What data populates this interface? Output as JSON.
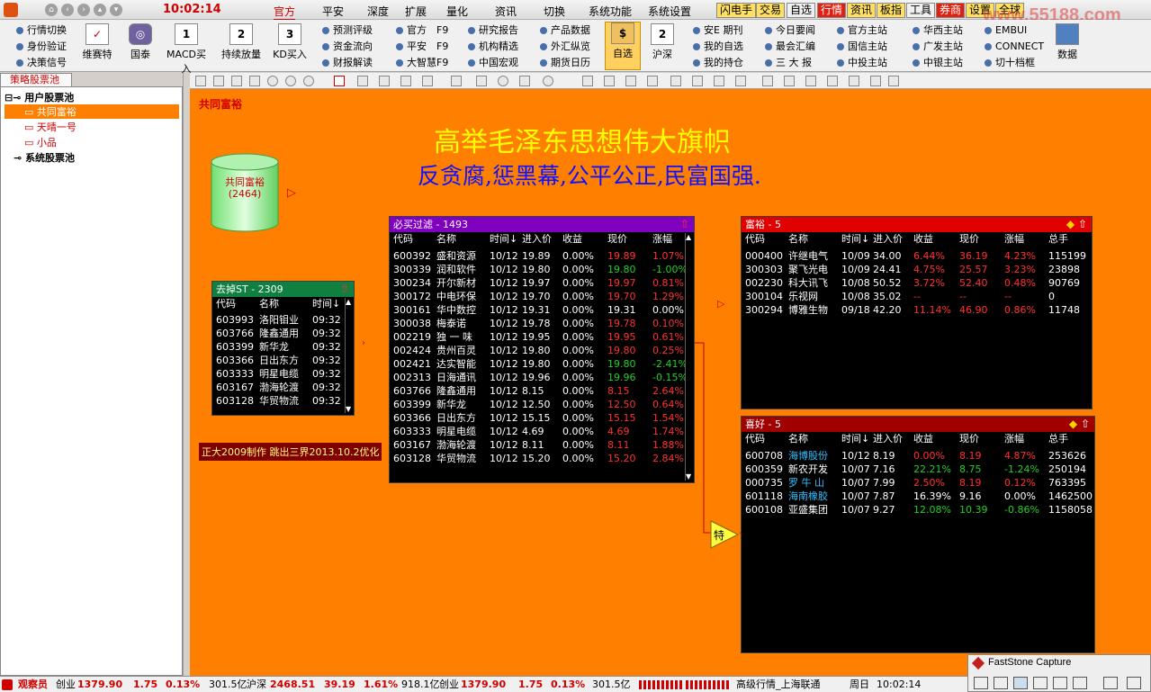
{
  "topbar": {
    "time": "10:02:14",
    "menus": [
      "官方",
      "平安",
      "深度",
      "扩展",
      "量化",
      "资讯",
      "切换",
      "系统功能",
      "系统设置"
    ],
    "buttons": [
      "闪电手",
      "交易",
      "自选",
      "行情",
      "资讯",
      "板指",
      "工具",
      "券商",
      "设置",
      "全球"
    ],
    "watermark": "www.55188.com"
  },
  "toolbar": {
    "col1": [
      "行情切换",
      "身份验证",
      "决策信号"
    ],
    "big1": [
      {
        "label": "维赛特",
        "icon": "check-icon"
      },
      {
        "label": "国泰",
        "icon": "gauge-icon"
      },
      {
        "label": "MACD买入",
        "num": "1"
      },
      {
        "label": "持续放量",
        "num": "2"
      },
      {
        "label": "KD买入",
        "num": "3"
      }
    ],
    "col2": [
      "预测评级",
      "资金流向",
      "财报解读"
    ],
    "col3": [
      "官方　F9",
      "平安　F9",
      "大智慧F9"
    ],
    "col4": [
      "研究报告",
      "机构精选",
      "中国宏观"
    ],
    "col5": [
      "产品数据",
      "外汇纵览",
      "期货日历"
    ],
    "big2": [
      {
        "label": "自选",
        "num": "$"
      },
      {
        "label": "沪深",
        "num": "2"
      }
    ],
    "col6": [
      "安E 期刊",
      "我的自选",
      "我的持仓"
    ],
    "col7": [
      "今日要闻",
      "最会汇编",
      "三 大 报"
    ],
    "col8": [
      "官方主站",
      "国信主站",
      "中投主站"
    ],
    "col9": [
      "华西主站",
      "广发主站",
      "中银主站"
    ],
    "col10": [
      "EMBUI",
      "CONNECT",
      "切十档框"
    ],
    "big3": {
      "label": "数据"
    }
  },
  "left": {
    "tab": "策略股票池",
    "tree": [
      {
        "label": "用户股票池",
        "level": 0,
        "bold": true
      },
      {
        "label": "共同富裕",
        "level": 1,
        "selected": true
      },
      {
        "label": "天晴一号",
        "level": 1
      },
      {
        "label": "小品",
        "level": 1
      },
      {
        "label": "系统股票池",
        "level": 0,
        "bold": true
      }
    ]
  },
  "canvas": {
    "pool_title": "共同富裕",
    "headline": "高举毛泽东思想伟大旗帜",
    "subline": "反贪腐,惩黑幕,公平公正,民富国强.",
    "cylinder": {
      "name": "共同富裕",
      "count": "(2464)"
    },
    "note": "正大2009制作 跳出三界2013.10.2优化",
    "special": "特"
  },
  "panels": {
    "qudiao": {
      "title": "去掉ST - 2309",
      "headers": [
        "代码",
        "名称",
        "时间↓"
      ],
      "rows": [
        [
          "603993",
          "洛阳钼业",
          "09:32"
        ],
        [
          "603766",
          "隆鑫通用",
          "09:32"
        ],
        [
          "603399",
          "新华龙",
          "09:32"
        ],
        [
          "603366",
          "日出东方",
          "09:32"
        ],
        [
          "603333",
          "明星电缆",
          "09:32"
        ],
        [
          "603167",
          "渤海轮渡",
          "09:32"
        ],
        [
          "603128",
          "华贸物流",
          "09:32"
        ]
      ]
    },
    "bimai": {
      "title": "必买过滤 - 1493",
      "headers": [
        "代码",
        "名称",
        "时间↓",
        "进入价",
        "收益",
        "现价",
        "涨幅"
      ],
      "rows": [
        [
          "600392",
          "盛和资源",
          "10/12",
          "19.89",
          "0.00%",
          "19.89",
          "1.07%",
          "r"
        ],
        [
          "300339",
          "润和软件",
          "10/12",
          "19.80",
          "0.00%",
          "19.80",
          "-1.00%",
          "g"
        ],
        [
          "300234",
          "开尔新材",
          "10/12",
          "19.97",
          "0.00%",
          "19.97",
          "0.81%",
          "r"
        ],
        [
          "300172",
          "中电环保",
          "10/12",
          "19.70",
          "0.00%",
          "19.70",
          "1.29%",
          "r"
        ],
        [
          "300161",
          "华中数控",
          "10/12",
          "19.31",
          "0.00%",
          "19.31",
          "0.00%",
          "w"
        ],
        [
          "300038",
          "梅泰诺",
          "10/12",
          "19.78",
          "0.00%",
          "19.78",
          "0.10%",
          "r"
        ],
        [
          "002219",
          "独 一 味",
          "10/12",
          "19.95",
          "0.00%",
          "19.95",
          "0.61%",
          "r"
        ],
        [
          "002424",
          "贵州百灵",
          "10/12",
          "19.80",
          "0.00%",
          "19.80",
          "0.25%",
          "r"
        ],
        [
          "002421",
          "达实智能",
          "10/12",
          "19.80",
          "0.00%",
          "19.80",
          "-2.41%",
          "g"
        ],
        [
          "002313",
          "日海通讯",
          "10/12",
          "19.96",
          "0.00%",
          "19.96",
          "-0.15%",
          "g"
        ],
        [
          "603766",
          "隆鑫通用",
          "10/12",
          "8.15",
          "0.00%",
          "8.15",
          "2.64%",
          "r"
        ],
        [
          "603399",
          "新华龙",
          "10/12",
          "12.50",
          "0.00%",
          "12.50",
          "0.64%",
          "r"
        ],
        [
          "603366",
          "日出东方",
          "10/12",
          "15.15",
          "0.00%",
          "15.15",
          "1.54%",
          "r"
        ],
        [
          "603333",
          "明星电缆",
          "10/12",
          "4.69",
          "0.00%",
          "4.69",
          "1.74%",
          "r"
        ],
        [
          "603167",
          "渤海轮渡",
          "10/12",
          "8.11",
          "0.00%",
          "8.11",
          "1.88%",
          "r"
        ],
        [
          "603128",
          "华贸物流",
          "10/12",
          "15.20",
          "0.00%",
          "15.20",
          "2.84%",
          "r"
        ]
      ]
    },
    "fuyu": {
      "title": "富裕 - 5",
      "headers": [
        "代码",
        "名称",
        "时间↓",
        "进入价",
        "收益",
        "现价",
        "涨幅",
        "总手"
      ],
      "rows": [
        [
          "000400",
          "许继电气",
          "10/09",
          "34.00",
          "6.44%",
          "36.19",
          "4.23%",
          "115199",
          "r",
          "w"
        ],
        [
          "300303",
          "聚飞光电",
          "10/09",
          "24.41",
          "4.75%",
          "25.57",
          "3.23%",
          "23898",
          "r",
          "w"
        ],
        [
          "002230",
          "科大讯飞",
          "10/08",
          "50.52",
          "3.72%",
          "52.40",
          "0.48%",
          "90769",
          "r",
          "w"
        ],
        [
          "300104",
          "乐视网",
          "10/08",
          "35.02",
          "--",
          "--",
          "--",
          "0",
          "r",
          "w"
        ],
        [
          "300294",
          "博雅生物",
          "09/18",
          "42.20",
          "11.14%",
          "46.90",
          "0.86%",
          "11748",
          "r",
          "w"
        ]
      ]
    },
    "xihao": {
      "title": "喜好 - 5",
      "headers": [
        "代码",
        "名称",
        "时间↓",
        "进入价",
        "收益",
        "现价",
        "涨幅",
        "总手"
      ],
      "rows": [
        [
          "600708",
          "海博股份",
          "10/12",
          "8.19",
          "0.00%",
          "8.19",
          "4.87%",
          "253626",
          "r",
          "c"
        ],
        [
          "600359",
          "新农开发",
          "10/07",
          "7.16",
          "22.21%",
          "8.75",
          "-1.24%",
          "250194",
          "g",
          "w"
        ],
        [
          "000735",
          "罗 牛 山",
          "10/07",
          "7.99",
          "2.50%",
          "8.19",
          "0.12%",
          "763395",
          "r",
          "c"
        ],
        [
          "601118",
          "海南橡胶",
          "10/07",
          "7.87",
          "16.39%",
          "9.16",
          "0.00%",
          "1462500",
          "w",
          "c"
        ],
        [
          "600108",
          "亚盛集团",
          "10/07",
          "9.27",
          "12.08%",
          "10.39",
          "-0.86%",
          "1158058",
          "g",
          "w"
        ]
      ]
    }
  },
  "status": {
    "user": "观察员",
    "cy1": "创业",
    "cy1v": "1379.90",
    "cy1c": "1.75",
    "cy1p": "0.13%",
    "cy1a": "301.5亿",
    "hs": "沪深",
    "hsv": "2468.51",
    "hsc": "39.19",
    "hsp": "1.61%",
    "hsa": "918.1亿",
    "cy2": "创业",
    "cy2v": "1379.90",
    "cy2c": "1.75",
    "cy2p": "0.13%",
    "cy2a": "301.5亿",
    "feed": "高级行情_上海联通",
    "day": "周日",
    "time": "10:02:14"
  },
  "capture": {
    "title": "FastStone Capture"
  },
  "colors": {
    "canvas": "#ff8000",
    "red": "#ff3030",
    "green": "#20d020"
  }
}
